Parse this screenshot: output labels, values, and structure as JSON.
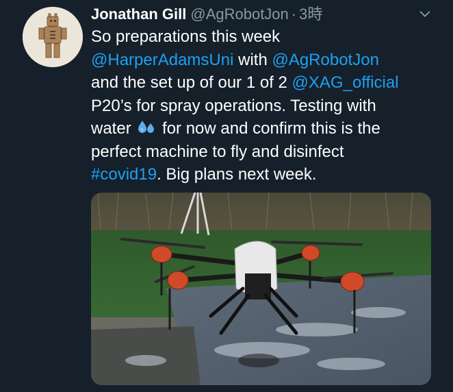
{
  "tweet": {
    "author_name": "Jonathan Gill",
    "author_handle": "@AgRobotJon",
    "separator": "·",
    "time": "3時",
    "text_segments": [
      {
        "text": "So preparations this week\n",
        "kind": "plain"
      },
      {
        "text": "@HarperAdamsUni",
        "kind": "mention"
      },
      {
        "text": " with ",
        "kind": "plain"
      },
      {
        "text": "@AgRobotJon",
        "kind": "mention"
      },
      {
        "text": "\nand the set up of our 1 of 2 ",
        "kind": "plain"
      },
      {
        "text": "@XAG_official",
        "kind": "mention"
      },
      {
        "text": "\nP20’s for spray operations. Testing with\nwater ",
        "kind": "plain"
      },
      {
        "text": "sweat-droplets-emoji",
        "kind": "emoji"
      },
      {
        "text": " for now and confirm this is the\nperfect machine to fly and disinfect\n",
        "kind": "plain"
      },
      {
        "text": "#covid19",
        "kind": "hashtag"
      },
      {
        "text": ". Big plans next week.",
        "kind": "plain"
      }
    ],
    "link_color": "#1da1f2",
    "background_color": "#15202b"
  },
  "icons": {
    "menu": "chevron-down-icon",
    "avatar": "avatar-robot-figure"
  },
  "media": {
    "description_icon": "drone-photo"
  }
}
